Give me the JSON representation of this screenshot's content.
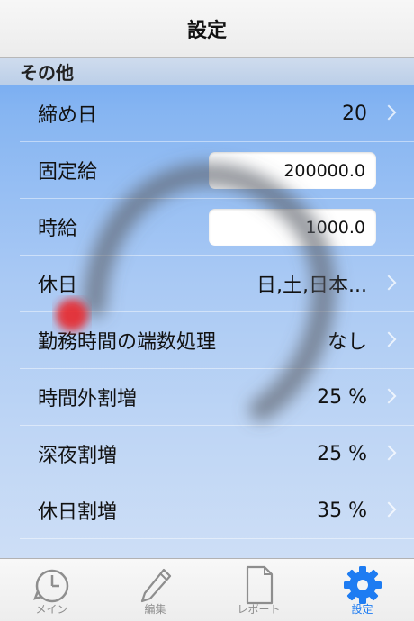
{
  "navbar": {
    "title": "設定"
  },
  "section": {
    "title": "その他"
  },
  "rows": [
    {
      "label": "締め日",
      "value": "20"
    },
    {
      "label": "固定給",
      "value": "200000.0"
    },
    {
      "label": "時給",
      "value": "1000.0"
    },
    {
      "label": "休日",
      "value": "日,土,日本..."
    },
    {
      "label": "勤務時間の端数処理",
      "value": "なし"
    },
    {
      "label": "時間外割増",
      "value": "25 %"
    },
    {
      "label": "深夜割増",
      "value": "25 %"
    },
    {
      "label": "休日割増",
      "value": "35 %"
    }
  ],
  "tabs": [
    {
      "label": "メイン",
      "icon": "timer-icon"
    },
    {
      "label": "編集",
      "icon": "pencil-icon"
    },
    {
      "label": "レポート",
      "icon": "document-icon"
    },
    {
      "label": "設定",
      "icon": "gear-icon",
      "active": true
    }
  ],
  "colors": {
    "accent": "#1e7cf2",
    "background": "#86b5f2"
  }
}
